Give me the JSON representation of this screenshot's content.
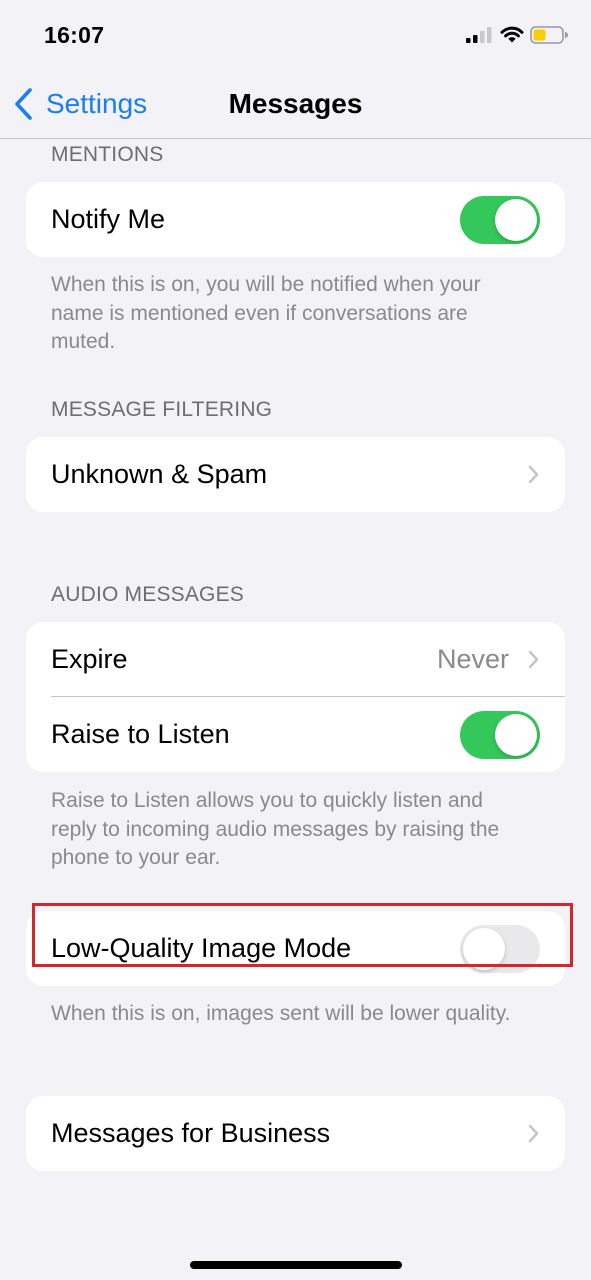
{
  "status_bar": {
    "time": "16:07",
    "signal_icon": "cellular-signal-icon",
    "wifi_icon": "wifi-icon",
    "battery_icon": "battery-low-icon",
    "battery_color": "#ffcc00"
  },
  "nav": {
    "back_label": "Settings",
    "back_icon": "chevron-left-icon",
    "title": "Messages",
    "accent": "#1a7ff0"
  },
  "sections": {
    "mentions": {
      "header": "MENTIONS",
      "notify_me": {
        "label": "Notify Me",
        "on": true
      },
      "footer": "When this is on, you will be notified when your name is mentioned even if conversations are muted."
    },
    "filtering": {
      "header": "MESSAGE FILTERING",
      "unknown_spam": {
        "label": "Unknown & Spam"
      }
    },
    "audio": {
      "header": "AUDIO MESSAGES",
      "expire": {
        "label": "Expire",
        "value": "Never"
      },
      "raise_to_listen": {
        "label": "Raise to Listen",
        "on": true
      },
      "footer": "Raise to Listen allows you to quickly listen and reply to incoming audio messages by raising the phone to your ear."
    },
    "low_quality": {
      "label": "Low-Quality Image Mode",
      "on": false,
      "highlight_color": "#d8242c",
      "footer": "When this is on, images sent will be lower quality."
    },
    "business": {
      "label": "Messages for Business"
    }
  },
  "colors": {
    "toggle_on": "#34c759",
    "toggle_off": "#e9e9eb",
    "background": "#f2f2f7"
  }
}
